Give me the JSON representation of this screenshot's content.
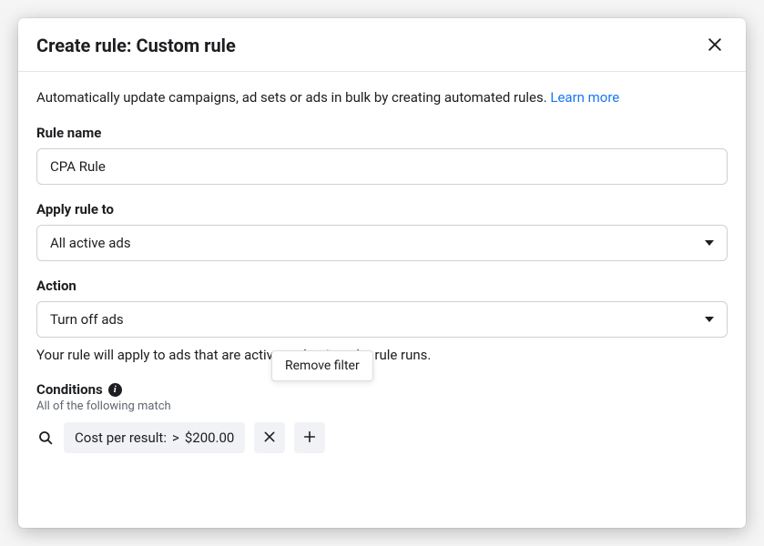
{
  "dialog": {
    "title": "Create rule: Custom rule",
    "description_text": "Automatically update campaigns, ad sets or ads in bulk by creating automated rules. ",
    "learn_more": "Learn more"
  },
  "rule_name": {
    "label": "Rule name",
    "value": "CPA Rule"
  },
  "apply_to": {
    "label": "Apply rule to",
    "value": "All active ads"
  },
  "action": {
    "label": "Action",
    "value": "Turn off ads",
    "help_text": "Your rule will apply to ads that are active at the time the rule runs."
  },
  "conditions": {
    "label": "Conditions",
    "subtext": "All of the following match",
    "tooltip": "Remove filter",
    "chip_metric": "Cost per result:",
    "chip_operator": ">",
    "chip_value": "$200.00"
  }
}
